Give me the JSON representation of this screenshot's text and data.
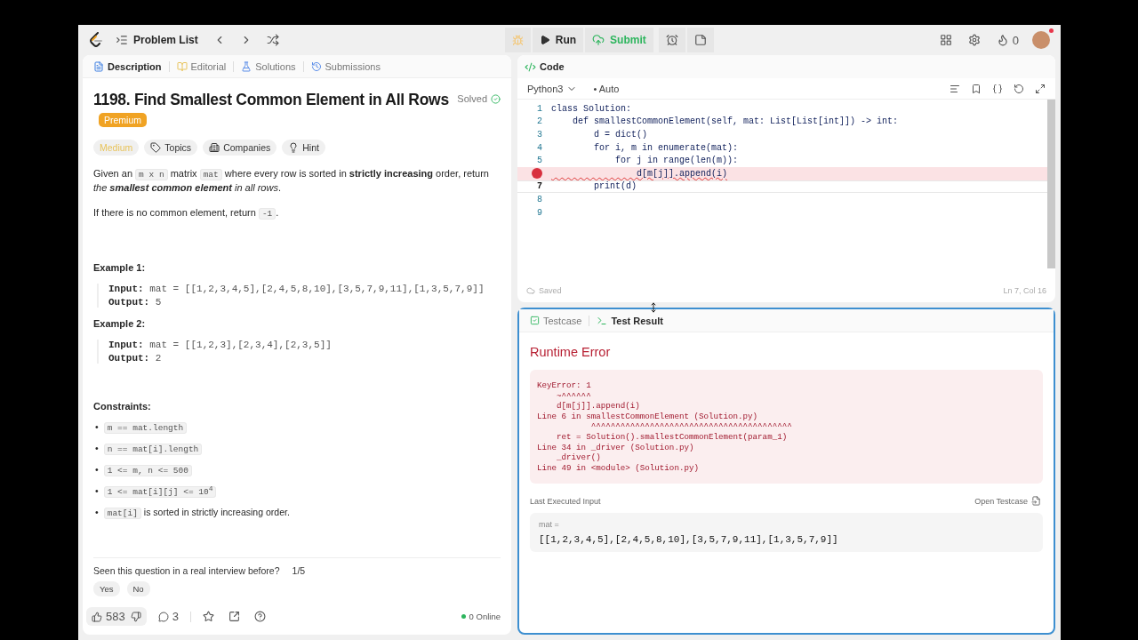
{
  "topbar": {
    "problem_list": "Problem List",
    "run": "Run",
    "submit": "Submit",
    "streak": "0"
  },
  "left_tabs": [
    {
      "label": "Description",
      "selected": true,
      "kind": "description"
    },
    {
      "label": "Editorial",
      "selected": false,
      "kind": "editorial"
    },
    {
      "label": "Solutions",
      "selected": false,
      "kind": "solutions"
    },
    {
      "label": "Submissions",
      "selected": false,
      "kind": "submissions"
    }
  ],
  "problem": {
    "title": "1198. Find Smallest Common Element in All Rows",
    "status": "Solved",
    "premium": "Premium",
    "tags": [
      {
        "label": "Medium",
        "kind": "difficulty"
      },
      {
        "label": "Topics",
        "kind": "topics"
      },
      {
        "label": "Companies",
        "kind": "companies"
      },
      {
        "label": "Hint",
        "kind": "hint"
      }
    ],
    "paragraphs": [
      [
        {
          "kind": "text",
          "text": "Given an "
        },
        {
          "kind": "code",
          "text": "m x n"
        },
        {
          "kind": "text",
          "text": " matrix "
        },
        {
          "kind": "code",
          "text": "mat"
        },
        {
          "kind": "text",
          "text": " where every row is sorted in **strictly increasing** order, return *the* "
        },
        {
          "kind": "bold_italic",
          "text": "smallest common element"
        },
        {
          "kind": "text",
          "text": " *in all rows*."
        }
      ],
      [
        {
          "kind": "text",
          "text": "If there is no common element, return "
        },
        {
          "kind": "code",
          "text": "-1"
        },
        {
          "kind": "text",
          "text": "."
        }
      ]
    ],
    "examples": [
      {
        "title": "Example 1:",
        "lines": [
          {
            "label": "Input:",
            "value": "mat = [[1,2,3,4,5],[2,4,5,8,10],[3,5,7,9,11],[1,3,5,7,9]]"
          },
          {
            "label": "Output:",
            "value": "5"
          }
        ]
      },
      {
        "title": "Example 2:",
        "lines": [
          {
            "label": "Input:",
            "value": "mat = [[1,2,3],[2,3,4],[2,3,5]]"
          },
          {
            "label": "Output:",
            "value": "2"
          }
        ]
      }
    ],
    "constraints_title": "Constraints:",
    "constraints": [
      {
        "bullet": "•",
        "parts": [
          {
            "kind": "code",
            "text": "m == mat.length"
          }
        ]
      },
      {
        "bullet": "•",
        "parts": [
          {
            "kind": "code",
            "text": "n == mat[i].length"
          }
        ]
      },
      {
        "bullet": "•",
        "parts": [
          {
            "kind": "code",
            "text": "1 <= m, n <= 500"
          }
        ]
      },
      {
        "bullet": "•",
        "parts": [
          {
            "kind": "code",
            "text": "1 <= mat[i][j] <= 10$^{4}$"
          }
        ]
      },
      {
        "bullet": "•",
        "parts": [
          {
            "kind": "code",
            "text": "mat[i]"
          },
          {
            "kind": "text",
            "text": " is sorted in strictly increasing order."
          }
        ]
      }
    ],
    "interview_question": "Seen this question in a real interview before?",
    "interview_count": "1/5",
    "answers": [
      "Yes",
      "No"
    ],
    "likes": "583",
    "comments": "3",
    "online": "0 Online"
  },
  "code_panel": {
    "title": "Code",
    "language": "Python3",
    "mode_marker": "•",
    "mode": "Auto",
    "lines": [
      {
        "number": "1",
        "text": "class Solution:",
        "error": false,
        "current": false
      },
      {
        "number": "2",
        "text": "    def smallestCommonElement(self, mat: List[List[int]]) -> int:",
        "error": false,
        "current": false
      },
      {
        "number": "3",
        "text": "        d = dict()",
        "error": false,
        "current": false
      },
      {
        "number": "4",
        "text": "        for i, m in enumerate(mat):",
        "error": false,
        "current": false
      },
      {
        "number": "5",
        "text": "            for j in range(len(m)):",
        "error": false,
        "current": false
      },
      {
        "text": "                d[m[j]].append(i)",
        "error": true,
        "current": false
      },
      {
        "number": "7",
        "text": "        print(d)",
        "error": false,
        "current": true
      },
      {
        "number": "8",
        "error": false,
        "current": false
      },
      {
        "number": "9",
        "error": false,
        "current": false
      }
    ],
    "saved": "Saved",
    "cursor": "Ln 7, Col 16"
  },
  "result_tabs": [
    {
      "label": "Testcase",
      "selected": false,
      "kind": "testcase"
    },
    {
      "label": "Test Result",
      "selected": true,
      "kind": "result"
    }
  ],
  "result": {
    "title": "Runtime Error",
    "trace": "KeyError: 1\n    ~^^^^^^\n    d[m[j]].append(i)\nLine 6 in smallestCommonElement (Solution.py)\n           ^^^^^^^^^^^^^^^^^^^^^^^^^^^^^^^^^^^^^^^^^\n    ret = Solution().smallestCommonElement(param_1)\nLine 34 in _driver (Solution.py)\n    _driver()\nLine 49 in <module> (Solution.py)",
    "last_input_label": "Last Executed Input",
    "open_testcase": "Open Testcase",
    "input_name": "mat =",
    "input_value": "[[1,2,3,4,5],[2,4,5,8,10],[3,5,7,9,11],[1,3,5,7,9]]"
  }
}
